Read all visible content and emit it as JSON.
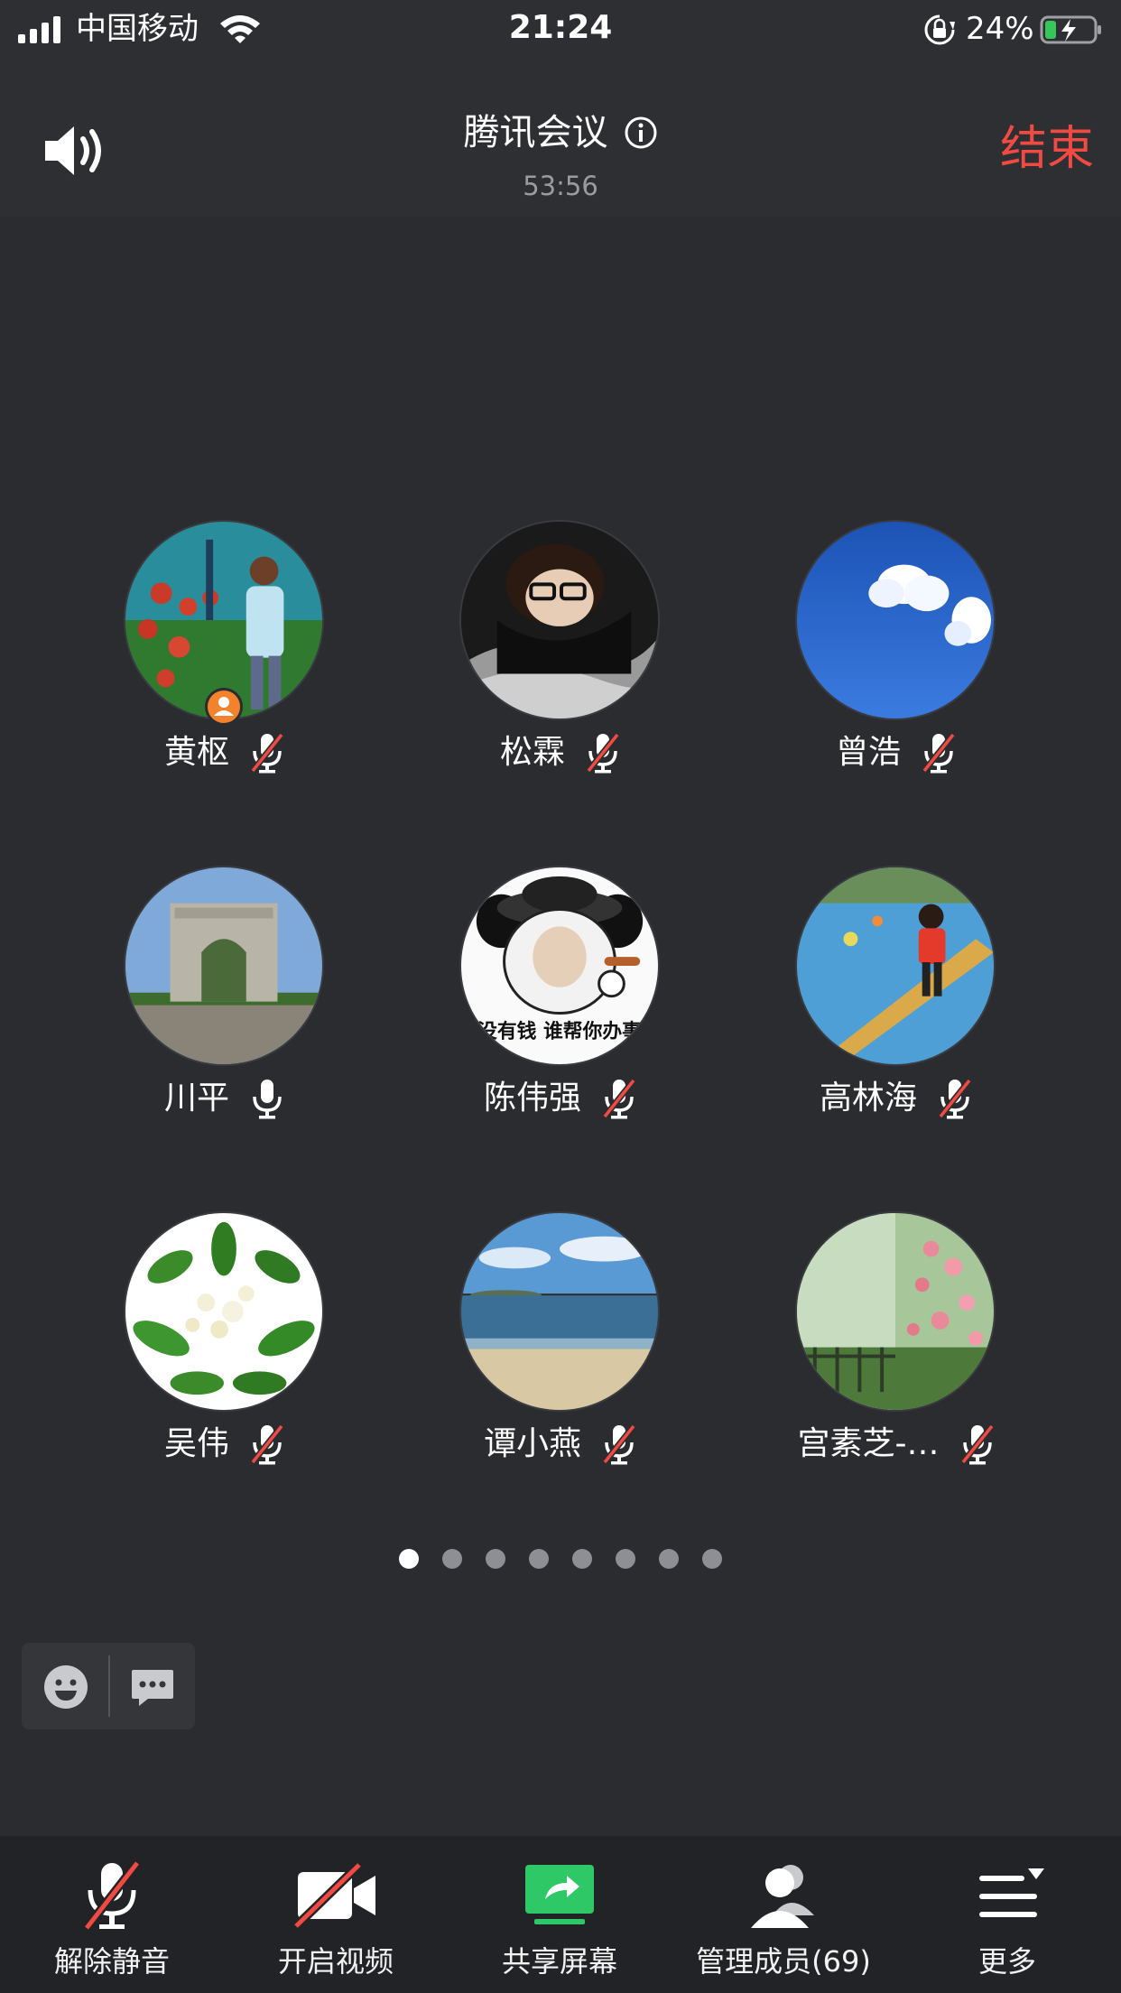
{
  "status_bar": {
    "carrier": "中国移动",
    "time": "21:24",
    "battery_percent": "24%",
    "battery_level": 0.24,
    "icons": [
      "signal-icon",
      "wifi-icon",
      "orientation-lock-icon",
      "battery-charging-icon"
    ]
  },
  "header": {
    "title": "腾讯会议",
    "elapsed": "53:56",
    "end_label": "结束",
    "end_color": "#f04a43",
    "icons": [
      "speaker-icon",
      "info-icon"
    ]
  },
  "participants": [
    {
      "name": "黄枢",
      "mic": "muted",
      "host": true,
      "avatar": "person-in-flower-field"
    },
    {
      "name": "松霖",
      "mic": "muted",
      "host": false,
      "avatar": "person-with-glasses"
    },
    {
      "name": "曾浩",
      "mic": "muted",
      "host": false,
      "avatar": "blue-sky-cloud"
    },
    {
      "name": "川平",
      "mic": "on",
      "host": false,
      "avatar": "stone-arch"
    },
    {
      "name": "陈伟强",
      "mic": "muted",
      "host": false,
      "avatar": "panda-meme",
      "avatar_text": "没有钱 谁帮你办事"
    },
    {
      "name": "高林海",
      "mic": "muted",
      "host": false,
      "avatar": "child-on-balance-beam"
    },
    {
      "name": "吴伟",
      "mic": "muted",
      "host": false,
      "avatar": "green-leaves-white-flowers"
    },
    {
      "name": "谭小燕",
      "mic": "muted",
      "host": false,
      "avatar": "sea-beach"
    },
    {
      "name": "宫素芝-…",
      "mic": "muted",
      "host": false,
      "avatar": "rose-garden"
    }
  ],
  "pagination": {
    "pages": 8,
    "current": 1
  },
  "mini_toolbar": {
    "icons": [
      "emoji-icon",
      "chat-icon"
    ]
  },
  "toolbar": {
    "unmute": "解除静音",
    "video": "开启视频",
    "share": "共享屏幕",
    "members": "管理成员(69)",
    "more": "更多",
    "share_color": "#2ec866"
  }
}
